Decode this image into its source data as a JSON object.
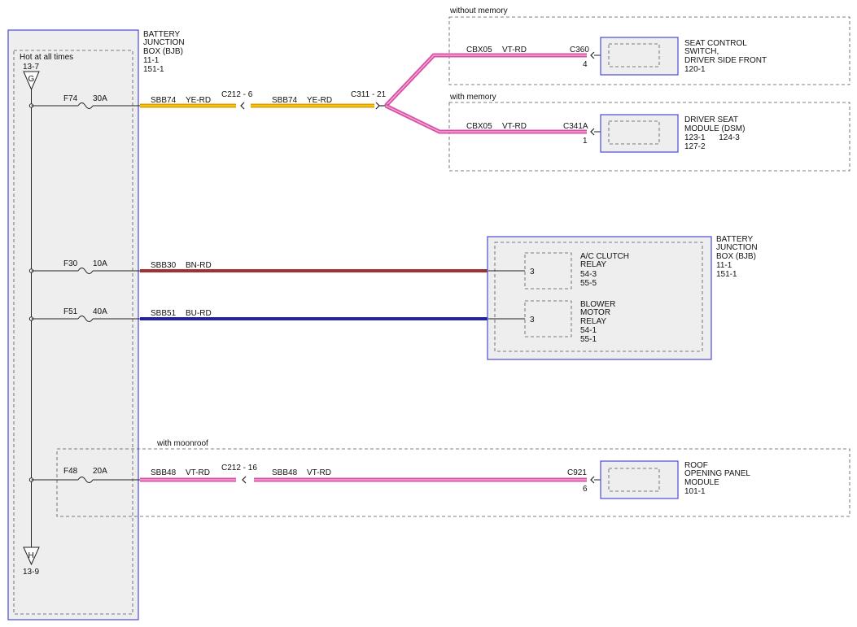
{
  "bjb_left": {
    "title_lines": [
      "BATTERY",
      "JUNCTION",
      "BOX (BJB)",
      "11-1",
      "151-1"
    ],
    "hot_label": "Hot at all times",
    "top_ref": "13-7",
    "top_connector": "G",
    "bottom_connector": "H",
    "bottom_ref": "13-9"
  },
  "fuses": [
    {
      "id": "F74",
      "rating": "30A"
    },
    {
      "id": "F30",
      "rating": "10A"
    },
    {
      "id": "F51",
      "rating": "40A"
    },
    {
      "id": "F48",
      "rating": "20A"
    }
  ],
  "circuits": {
    "sbb74_a": {
      "name": "SBB74",
      "color": "YE-RD"
    },
    "sbb74_b": {
      "name": "SBB74",
      "color": "YE-RD"
    },
    "sbb30": {
      "name": "SBB30",
      "color": "BN-RD"
    },
    "sbb51": {
      "name": "SBB51",
      "color": "BU-RD"
    },
    "sbb48_a": {
      "name": "SBB48",
      "color": "VT-RD"
    },
    "sbb48_b": {
      "name": "SBB48",
      "color": "VT-RD"
    },
    "cbx05_a": {
      "name": "CBX05",
      "color": "VT-RD"
    },
    "cbx05_b": {
      "name": "CBX05",
      "color": "VT-RD"
    }
  },
  "connectors": {
    "c212_6": "C212 - 6",
    "c311_21": "C311 - 21",
    "c212_16": "C212 - 16",
    "c360": "C360",
    "c360_pin": "4",
    "c341a": "C341A",
    "c341a_pin": "1",
    "c921": "C921",
    "c921_pin": "6"
  },
  "options": {
    "without_memory": "without memory",
    "with_memory": "with memory",
    "with_moonroof": "with moonroof"
  },
  "components": {
    "seat_switch": [
      "SEAT CONTROL",
      "SWITCH,",
      "DRIVER SIDE FRONT",
      "120-1"
    ],
    "dsm": [
      "DRIVER SEAT",
      "MODULE (DSM)",
      "123-1      124-3",
      "127-2"
    ],
    "bjb_right": [
      "BATTERY",
      "JUNCTION",
      "BOX (BJB)",
      "11-1",
      "151-1"
    ],
    "ac_relay": [
      "A/C CLUTCH",
      "RELAY",
      "54-3",
      "55-5"
    ],
    "ac_relay_pin": "3",
    "blower_relay": [
      "BLOWER",
      "MOTOR",
      "RELAY",
      "54-1",
      "55-1"
    ],
    "blower_relay_pin": "3",
    "roof": [
      "ROOF",
      "OPENING PANEL",
      "MODULE",
      "101-1"
    ]
  },
  "colors": {
    "box_border": "#4a4ad6",
    "box_fill": "#eeeeee",
    "ye_rd_main": "#e0a000",
    "ye_rd_stripe": "#f2d21a",
    "bn_rd": "#a33030",
    "bu_rd": "#24249a",
    "vt_rd_main": "#d94fa4",
    "vt_rd_stripe": "#f0a8d6",
    "wire_dark": "#222222"
  }
}
